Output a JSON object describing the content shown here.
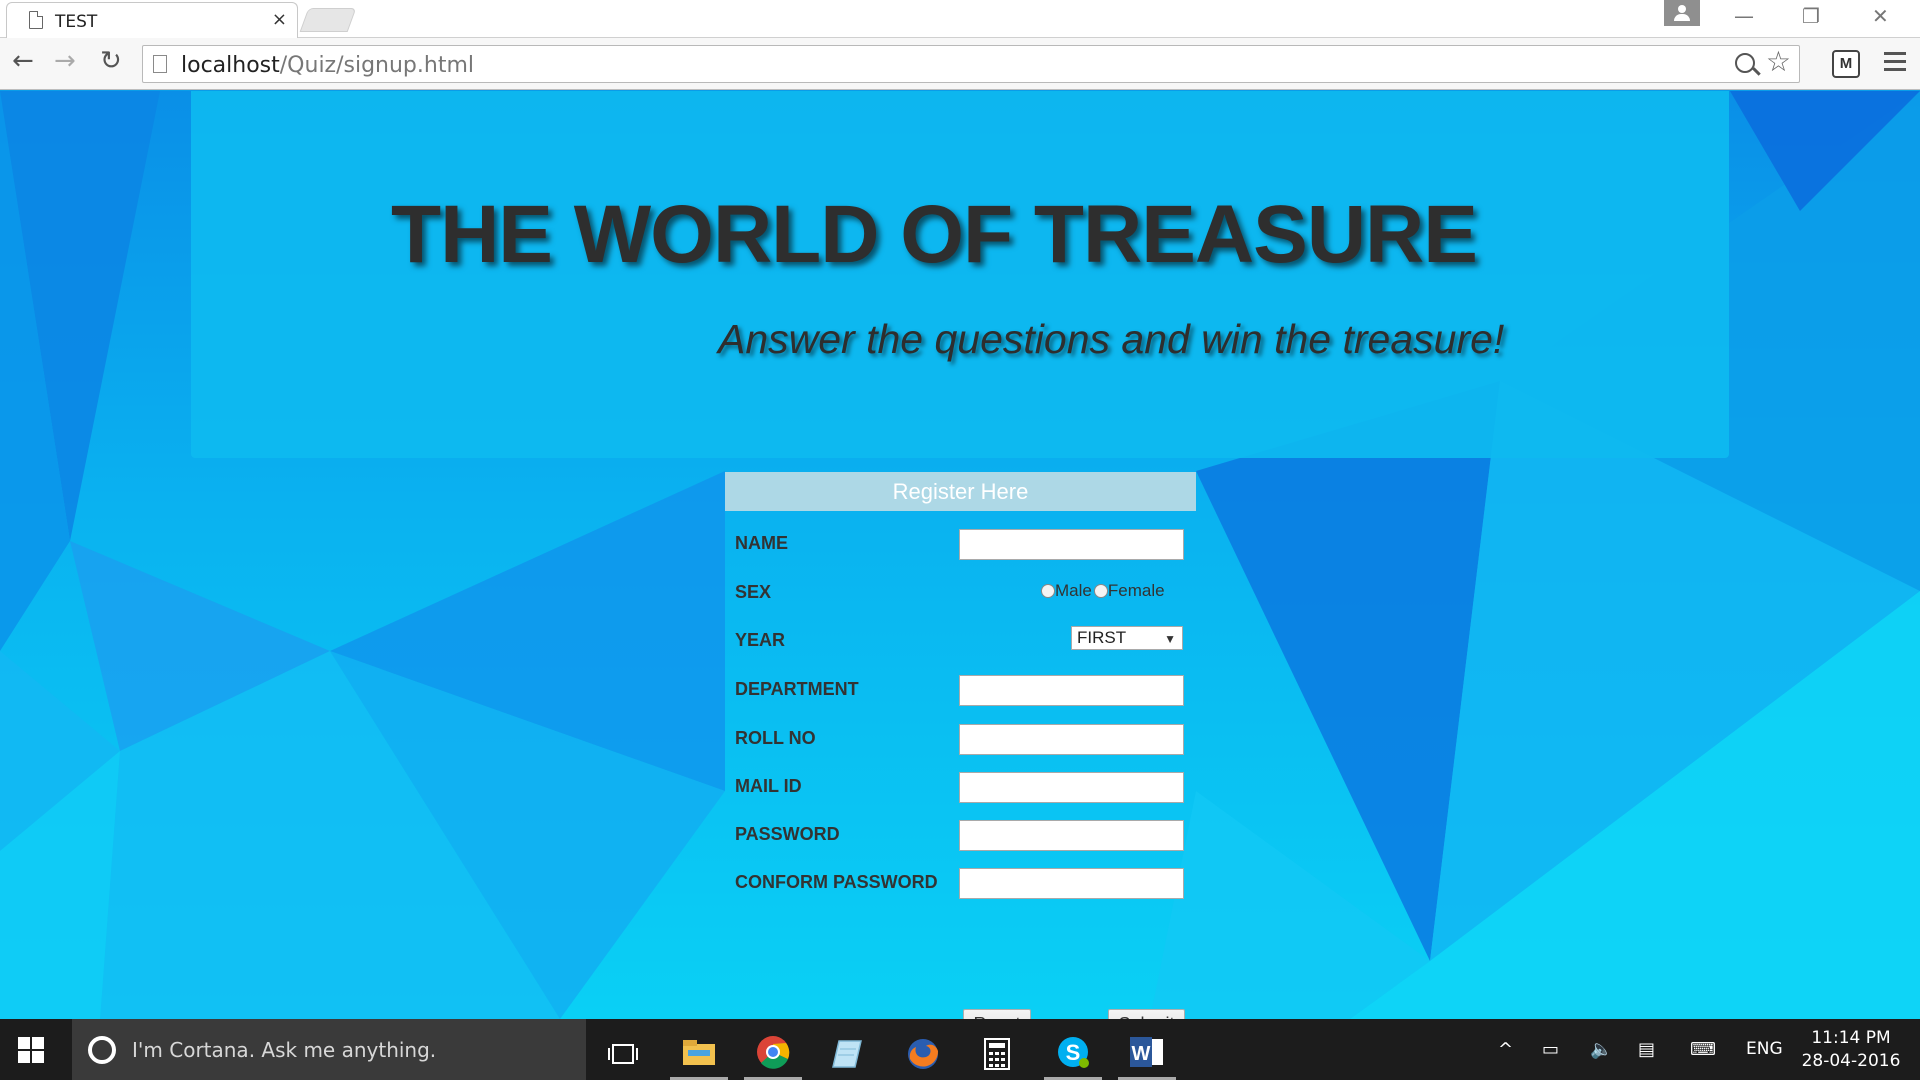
{
  "browser": {
    "tab_title": "TEST",
    "tab_close": "×",
    "url_host": "localhost",
    "url_path": "/Quiz/signup.html"
  },
  "hero": {
    "title": "THE WORLD OF TREASURE",
    "subtitle": "Answer the questions and win the treasure!"
  },
  "form": {
    "header": "Register Here",
    "labels": {
      "name": "NAME",
      "sex": "SEX",
      "year": "YEAR",
      "department": "DEPARTMENT",
      "roll_no": "ROLL NO",
      "mail_id": "MAIL ID",
      "password": "PASSWORD",
      "confirm_password": "CONFORM PASSWORD"
    },
    "sex_options": {
      "male": "Male",
      "female": "Female"
    },
    "year_selected": "FIRST",
    "values": {
      "name": "",
      "department": "",
      "roll_no": "",
      "mail_id": "",
      "password": "",
      "confirm_password": ""
    },
    "reset_label": "Reset",
    "submit_label": "Submit"
  },
  "taskbar": {
    "search_placeholder": "I'm Cortana. Ask me anything.",
    "apps": [
      "task-view",
      "file-explorer",
      "chrome",
      "notepad",
      "firefox",
      "calculator",
      "skype",
      "word"
    ],
    "language": "ENG",
    "time": "11:14 PM",
    "date": "28-04-2016"
  },
  "colors": {
    "page_background": "#0a9ce8",
    "hero_panel": "#0ebaf0",
    "form_header": "#add8e6",
    "title_text": "#2e2e2e",
    "taskbar": "#1c1c1c"
  }
}
